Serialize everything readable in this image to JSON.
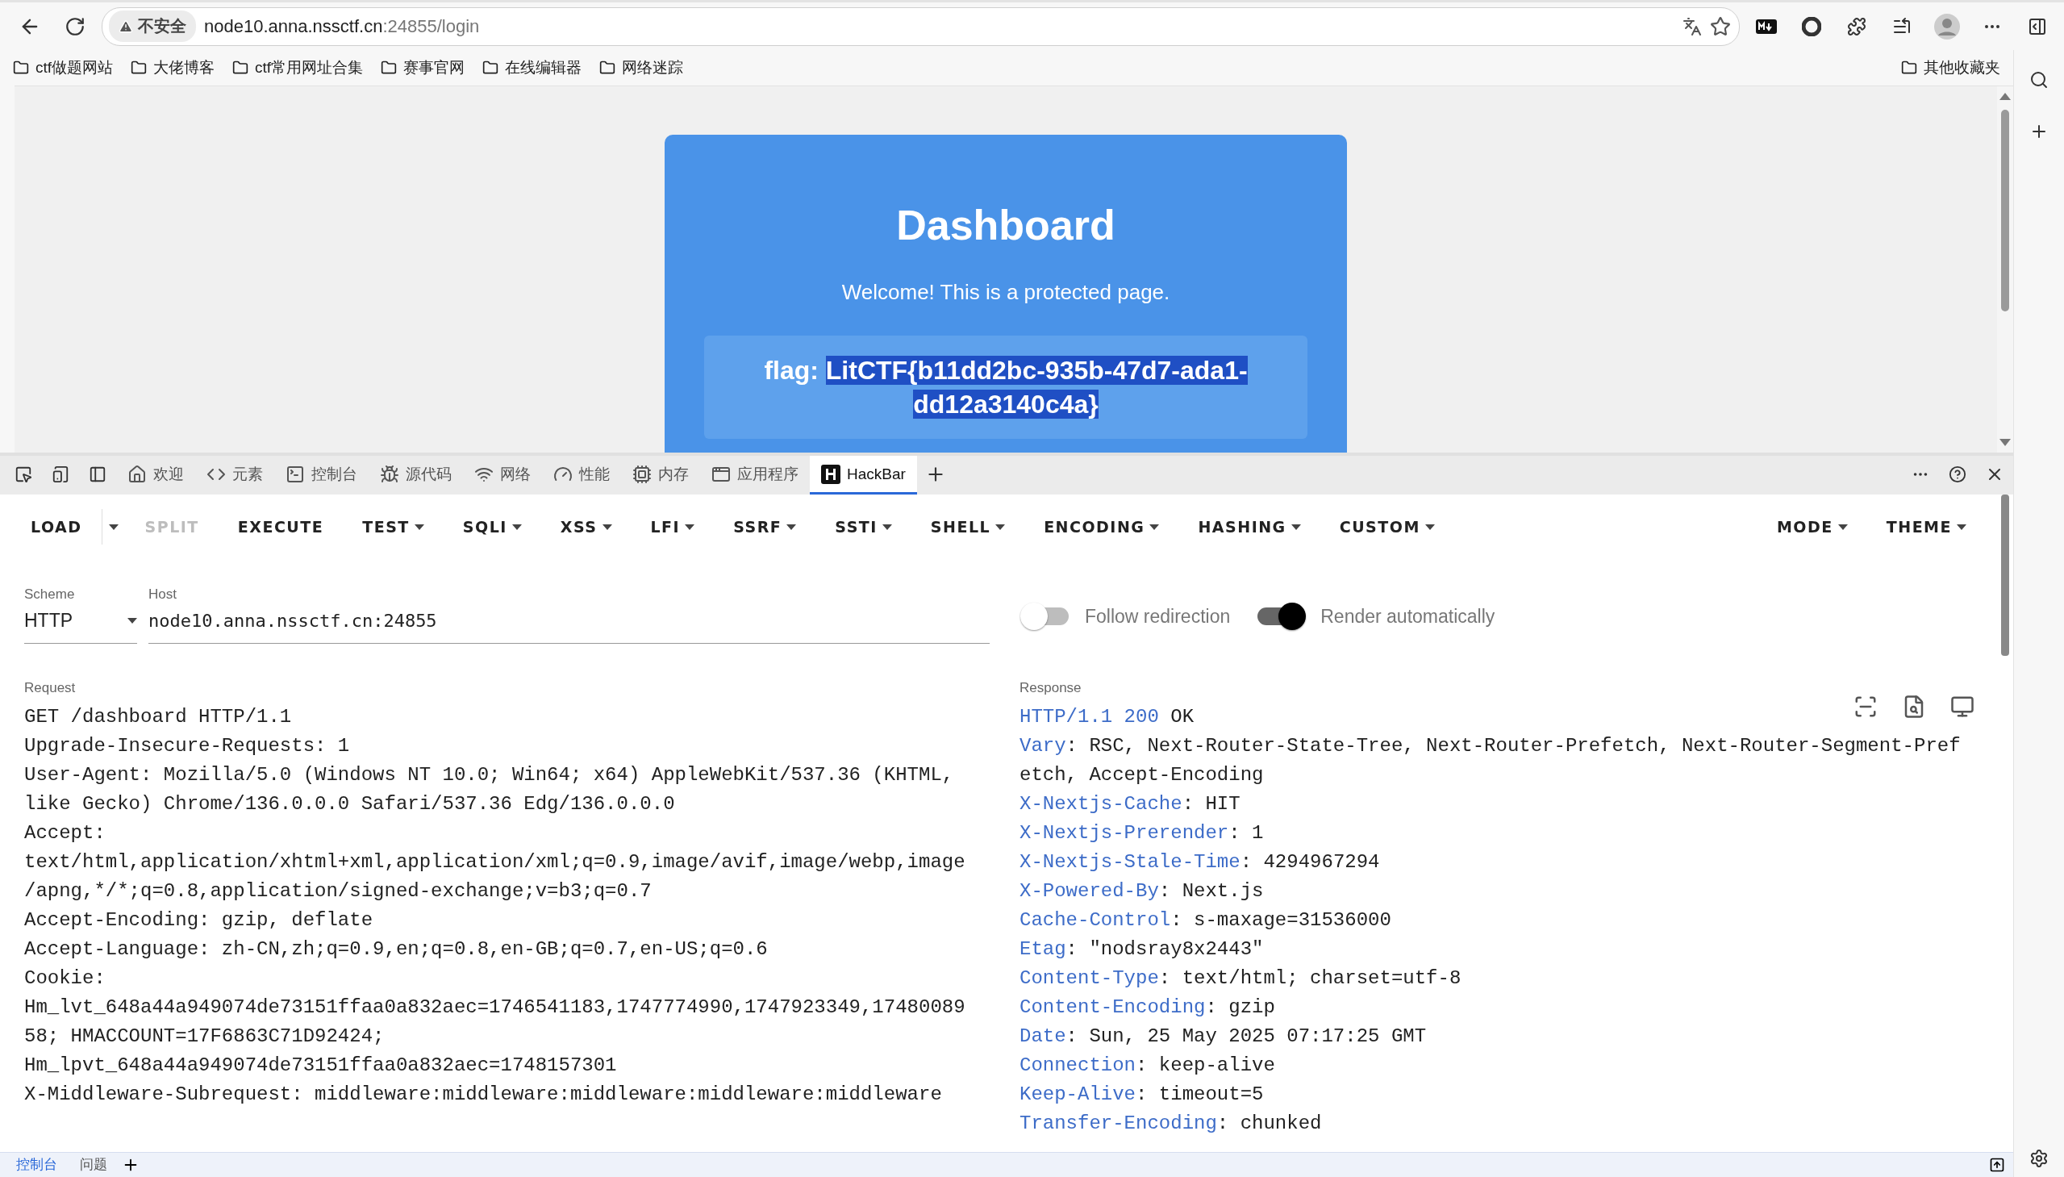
{
  "browser": {
    "security_label": "不安全",
    "url_host": "node10.anna.nssctf.cn",
    "url_rest": ":24855/login"
  },
  "bookmarks": [
    "ctf做题网站",
    "大佬博客",
    "ctf常用网址合集",
    "赛事官网",
    "在线编辑器",
    "网络迷踪"
  ],
  "other_bookmarks": "其他收藏夹",
  "page": {
    "title": "Dashboard",
    "subtitle": "Welcome! This is a protected page.",
    "flag_label": "flag:",
    "flag_value": "LitCTF{b11dd2bc-935b-47d7-ada1-dd12a3140c4a}",
    "flag_selected": true
  },
  "devtools_tabs": [
    {
      "label": "欢迎",
      "selected": false
    },
    {
      "label": "元素",
      "selected": false
    },
    {
      "label": "控制台",
      "selected": false
    },
    {
      "label": "源代码",
      "selected": false
    },
    {
      "label": "网络",
      "selected": false
    },
    {
      "label": "性能",
      "selected": false
    },
    {
      "label": "内存",
      "selected": false
    },
    {
      "label": "应用程序",
      "selected": false
    },
    {
      "label": "HackBar",
      "selected": true
    }
  ],
  "hackbar": {
    "toolbar": [
      {
        "label": "LOAD",
        "kind": "split",
        "disabled": false
      },
      {
        "label": "SPLIT",
        "kind": "plain",
        "disabled": true
      },
      {
        "label": "EXECUTE",
        "kind": "plain",
        "disabled": false
      },
      {
        "label": "TEST",
        "kind": "menu",
        "disabled": false
      },
      {
        "label": "SQLI",
        "kind": "menu",
        "disabled": false
      },
      {
        "label": "XSS",
        "kind": "menu",
        "disabled": false
      },
      {
        "label": "LFI",
        "kind": "menu",
        "disabled": false
      },
      {
        "label": "SSRF",
        "kind": "menu",
        "disabled": false
      },
      {
        "label": "SSTI",
        "kind": "menu",
        "disabled": false
      },
      {
        "label": "SHELL",
        "kind": "menu",
        "disabled": false
      },
      {
        "label": "ENCODING",
        "kind": "menu",
        "disabled": false
      },
      {
        "label": "HASHING",
        "kind": "menu",
        "disabled": false
      },
      {
        "label": "CUSTOM",
        "kind": "menu",
        "disabled": false
      }
    ],
    "toolbar_right": [
      {
        "label": "MODE",
        "kind": "menu",
        "disabled": false
      },
      {
        "label": "THEME",
        "kind": "menu",
        "disabled": false
      }
    ],
    "scheme": {
      "label": "Scheme",
      "value": "HTTP"
    },
    "host": {
      "label": "Host",
      "value": "node10.anna.nssctf.cn:24855"
    },
    "toggles": [
      {
        "label": "Follow redirection",
        "on": false
      },
      {
        "label": "Render automatically",
        "on": true
      }
    ],
    "request": {
      "label": "Request",
      "lines": [
        "GET /dashboard HTTP/1.1",
        "Upgrade-Insecure-Requests: 1",
        "User-Agent: Mozilla/5.0 (Windows NT 10.0; Win64; x64) AppleWebKit/537.36 (KHTML,",
        "like Gecko) Chrome/136.0.0.0 Safari/537.36 Edg/136.0.0.0",
        "Accept:",
        "text/html,application/xhtml+xml,application/xml;q=0.9,image/avif,image/webp,image",
        "/apng,*/*;q=0.8,application/signed-exchange;v=b3;q=0.7",
        "Accept-Encoding: gzip, deflate",
        "Accept-Language: zh-CN,zh;q=0.9,en;q=0.8,en-GB;q=0.7,en-US;q=0.6",
        "Cookie:",
        "Hm_lvt_648a44a949074de73151ffaa0a832aec=1746541183,1747774990,1747923349,17480089",
        "58; HMACCOUNT=17F6863C71D92424;",
        "Hm_lpvt_648a44a949074de73151ffaa0a832aec=1748157301",
        "X-Middleware-Subrequest: middleware:middleware:middleware:middleware:middleware"
      ]
    },
    "response": {
      "label": "Response",
      "lines": [
        {
          "kind": "status",
          "name": "HTTP/1.1 200",
          "value": "OK"
        },
        {
          "kind": "header",
          "name": "Vary",
          "value": ": RSC, Next-Router-State-Tree, Next-Router-Prefetch, Next-Router-Segment-Pref"
        },
        {
          "kind": "continuation",
          "value": "etch, Accept-Encoding"
        },
        {
          "kind": "header",
          "name": "X-Nextjs-Cache",
          "value": ": HIT"
        },
        {
          "kind": "header",
          "name": "X-Nextjs-Prerender",
          "value": ": 1"
        },
        {
          "kind": "header",
          "name": "X-Nextjs-Stale-Time",
          "value": ": 4294967294"
        },
        {
          "kind": "header",
          "name": "X-Powered-By",
          "value": ": Next.js"
        },
        {
          "kind": "header",
          "name": "Cache-Control",
          "value": ": s-maxage=31536000"
        },
        {
          "kind": "header",
          "name": "Etag",
          "value": ": \"nodsray8x2443\""
        },
        {
          "kind": "header",
          "name": "Content-Type",
          "value": ": text/html; charset=utf-8"
        },
        {
          "kind": "header",
          "name": "Content-Encoding",
          "value": ": gzip"
        },
        {
          "kind": "header",
          "name": "Date",
          "value": ": Sun, 25 May 2025 07:17:25 GMT"
        },
        {
          "kind": "header",
          "name": "Connection",
          "value": ": keep-alive"
        },
        {
          "kind": "header",
          "name": "Keep-Alive",
          "value": ": timeout=5"
        },
        {
          "kind": "header",
          "name": "Transfer-Encoding",
          "value": ": chunked"
        }
      ]
    }
  },
  "drawer_tabs": [
    {
      "label": "控制台",
      "selected": true
    },
    {
      "label": "问题",
      "selected": false
    }
  ]
}
